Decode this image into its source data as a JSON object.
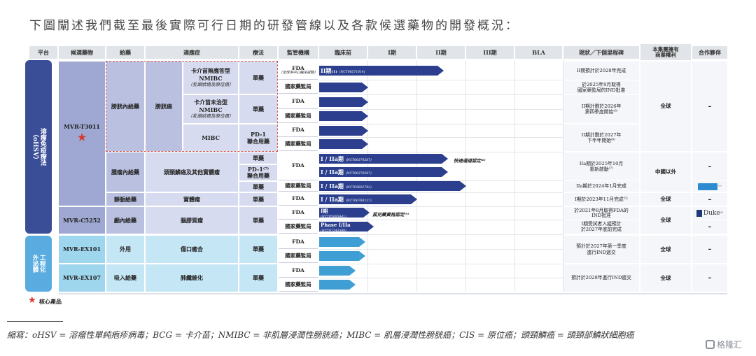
{
  "heading": "下圖闡述我們截至最後實際可行日期的研發管線以及各款候選藥物的開發概況：",
  "columns": {
    "platform": "平台",
    "candidate": "候選藥物",
    "route": "給藥",
    "indication": "適應症",
    "therapy": "療法",
    "regulator": "監管機構",
    "preclinical": "臨床前",
    "phase1": "I期",
    "phase2": "II期",
    "phase3": "III期",
    "bla": "BLA",
    "status": "現狀／下個里程碑",
    "rights": "本集團擁有\n商業權利",
    "partner": "合作夥伴"
  },
  "platforms": {
    "ohsv": "溶瘤免疫療法\n（oHSV）",
    "engineered": "工程化\n外泌體"
  },
  "candidates": {
    "t3011": "MVR-T3011",
    "c5252": "MVR-C5252",
    "ex101": "MVR-EX101",
    "ex107": "MVR-EX107"
  },
  "routes": {
    "intravesical": "膀胱內給藥",
    "intratumoral": "腫瘤內給藥",
    "intravenous": "靜脈給藥",
    "intracranial": "顱內給藥",
    "topical": "外用",
    "inhaled": "吸入給藥"
  },
  "indications": {
    "bladder": "膀胱癌",
    "nmibc_unresponsive": "卡介苗無應答型NMIBC",
    "nmibc_unresponsive_sub": "（乳頭狀癌及原位癌）",
    "nmibc_naive": "卡介苗未治型NMIBC",
    "nmibc_naive_sub": "（乳頭狀癌及原位癌）",
    "mibc": "MIBC",
    "hnscc": "頭頸鱗癌及其他實體瘤",
    "solid": "實體瘤",
    "gbm": "腦膠質瘤",
    "wound": "傷口癒合",
    "ipf": "肺纖維化"
  },
  "therapies": {
    "mono": "單藥",
    "pd1_combo": "PD-1\n聯合用藥",
    "pd1_combo_sup": "PD-1⁽⁷⁾\n聯合用藥"
  },
  "regulators": {
    "fda": "FDA",
    "fda_multi": "（全球多中心臨床試驗）",
    "nmpa": "國家藥監局"
  },
  "bars": {
    "b1": {
      "label": "II期",
      "sup": "(1)",
      "nct": "(NCT06571614)"
    },
    "b2": {
      "label": "I / IIa期",
      "nct": "(NCT06370587)"
    },
    "b3": {
      "label": "I / IIa期",
      "nct": "(NCT06370587)"
    },
    "b4": {
      "label": "I / IIa期",
      "nct": "(NCT05602792)"
    },
    "b5": {
      "label": "I / IIa期",
      "nct": "(NCT06780137)"
    },
    "b6": {
      "label": "I期",
      "nct": "(NCT05095441)"
    },
    "b7": {
      "label": "Phase I/IIa",
      "nct": "(NCT07243349)"
    }
  },
  "notes": {
    "fast_track": "快速通道認定⁽⁸⁾",
    "orphan": "孤兒藥資格認定⁽⁹⁾"
  },
  "status": {
    "s1": "II期預計於2028年完成",
    "s2": "於2025年9月取得\n國家藥監局的IND批准",
    "s3": "II期計劃於2026年\n第四季度開始⁽⁶⁾",
    "s4": "II期計劃於2027年\n下半年開始⁽⁶⁾",
    "s5": "IIa期於2025年10月\n重新啟動⁽⁷⁾",
    "s6": "IIa期於2024年1月完成",
    "s7": "I期於2023年11月完成⁽⁵⁾",
    "s8": "於2021年8月取得FDA的\nIND批准",
    "s9": "I期受試者入組預計\n於2027年底前完成",
    "s10": "預計於2027年第一季度\n進行IND遞交",
    "s11": "預計於2028年進行IND遞交"
  },
  "rights": {
    "global": "全球",
    "ex_china": "中國以外"
  },
  "partners": {
    "dash": "–",
    "duke": "Duke",
    "duke_sup": "⁽⁶⁾",
    "partner_logo_sup": "⁽³⁾"
  },
  "legend": {
    "star": "★",
    "core": "核心產品"
  },
  "abbreviations": "縮寫：oHSV = 溶瘤性單純疱疹病毒；BCG = 卡介苗；NMIBC = 非肌層浸潤性膀胱癌；MIBC = 肌層浸潤性膀胱癌；CIS = 原位癌；頭頸鱗癌 = 頭頸部鱗狀細胞癌",
  "watermark": "格隆汇",
  "colors": {
    "navy": "#2b3f8e",
    "cyan": "#3f9fd5",
    "platform_ohsv": "#3a4e98",
    "platform_exo": "#5aace0",
    "star": "#d63a2f"
  }
}
